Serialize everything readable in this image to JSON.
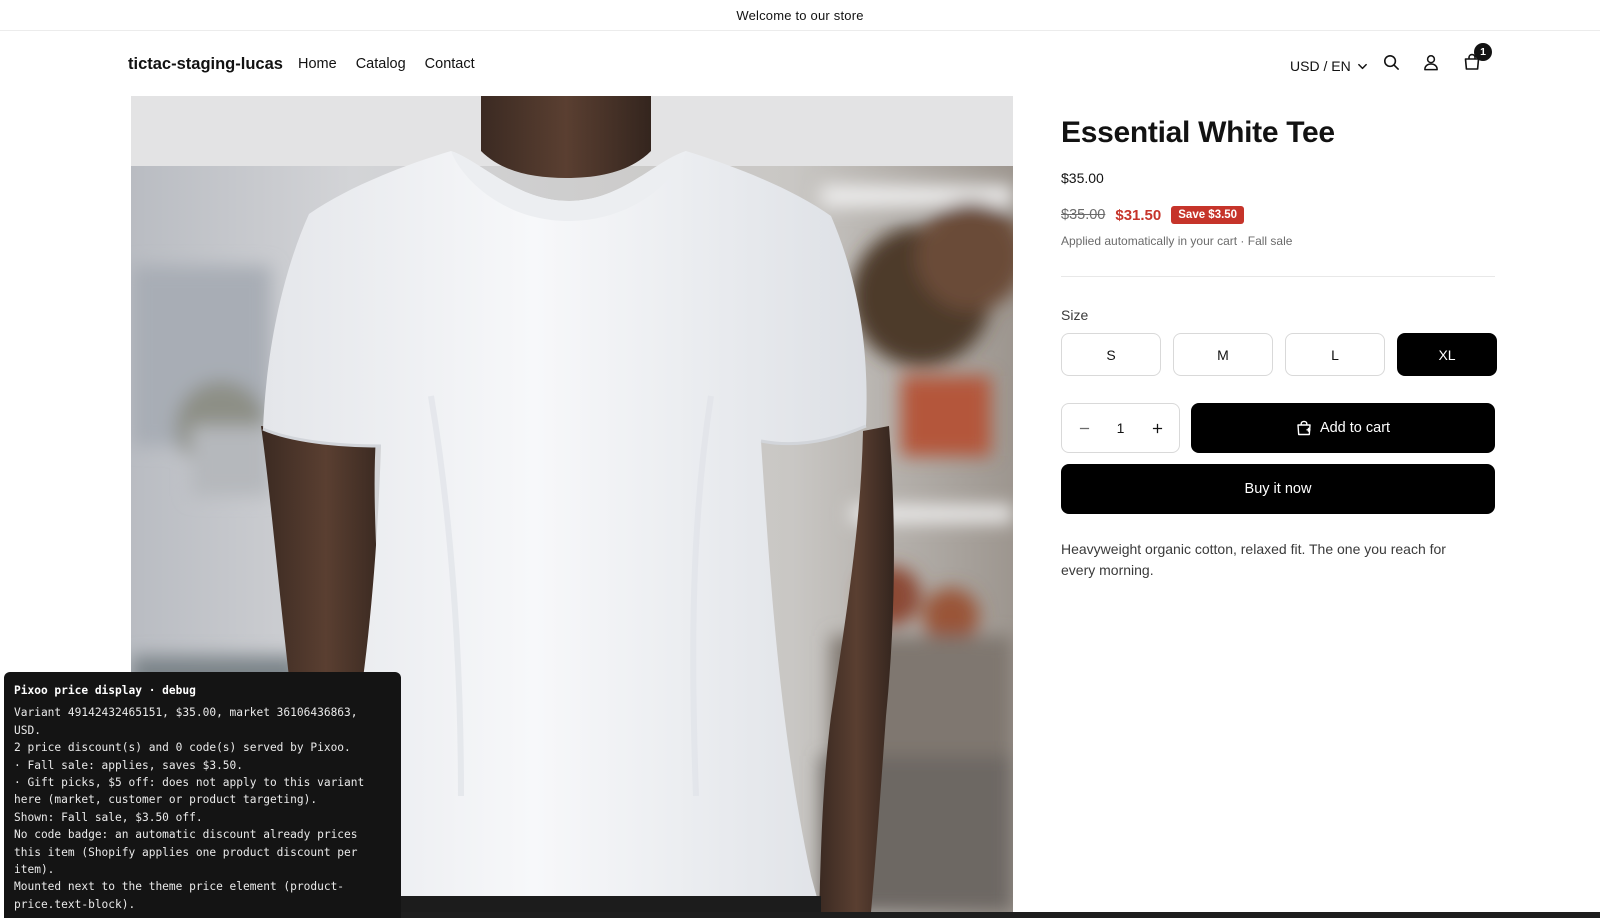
{
  "announcement": {
    "text": "Welcome to our store"
  },
  "header": {
    "brand": "tictac-staging-lucas",
    "nav": [
      {
        "label": "Home"
      },
      {
        "label": "Catalog"
      },
      {
        "label": "Contact"
      }
    ],
    "locale": "USD / EN",
    "cart_count": "1",
    "icons": [
      "search-icon",
      "account-icon",
      "cart-icon",
      "chevron-down-icon"
    ]
  },
  "product": {
    "title": "Essential White Tee",
    "regular_price": "$35.00",
    "compare_price": "$35.00",
    "sale_price": "$31.50",
    "save_badge": "Save $3.50",
    "applied_note": "Applied automatically in your cart · Fall sale",
    "size_label": "Size",
    "sizes": [
      "S",
      "M",
      "L",
      "XL"
    ],
    "selected_size": "XL",
    "quantity": "1",
    "add_to_cart_label": "Add to cart",
    "buy_now_label": "Buy it now",
    "description": "Heavyweight organic cotton, relaxed fit. The one you reach for every morning.",
    "colors": {
      "sale": "#c6342a",
      "button": "#000000"
    }
  },
  "debug": {
    "title": "Pixoo price display · debug",
    "lines": [
      "Variant 49142432465151, $35.00, market 36106436863, USD.",
      "2 price discount(s) and 0 code(s) served by Pixoo.",
      "· Fall sale: applies, saves $3.50.",
      "· Gift picks, $5 off: does not apply to this variant here (market, customer or product targeting).",
      "Shown: Fall sale, $3.50 off.",
      "No code badge: an automatic discount already prices this item (Shopify applies one product discount per item).",
      "Mounted next to the theme price element (product-price.text-block)."
    ]
  }
}
